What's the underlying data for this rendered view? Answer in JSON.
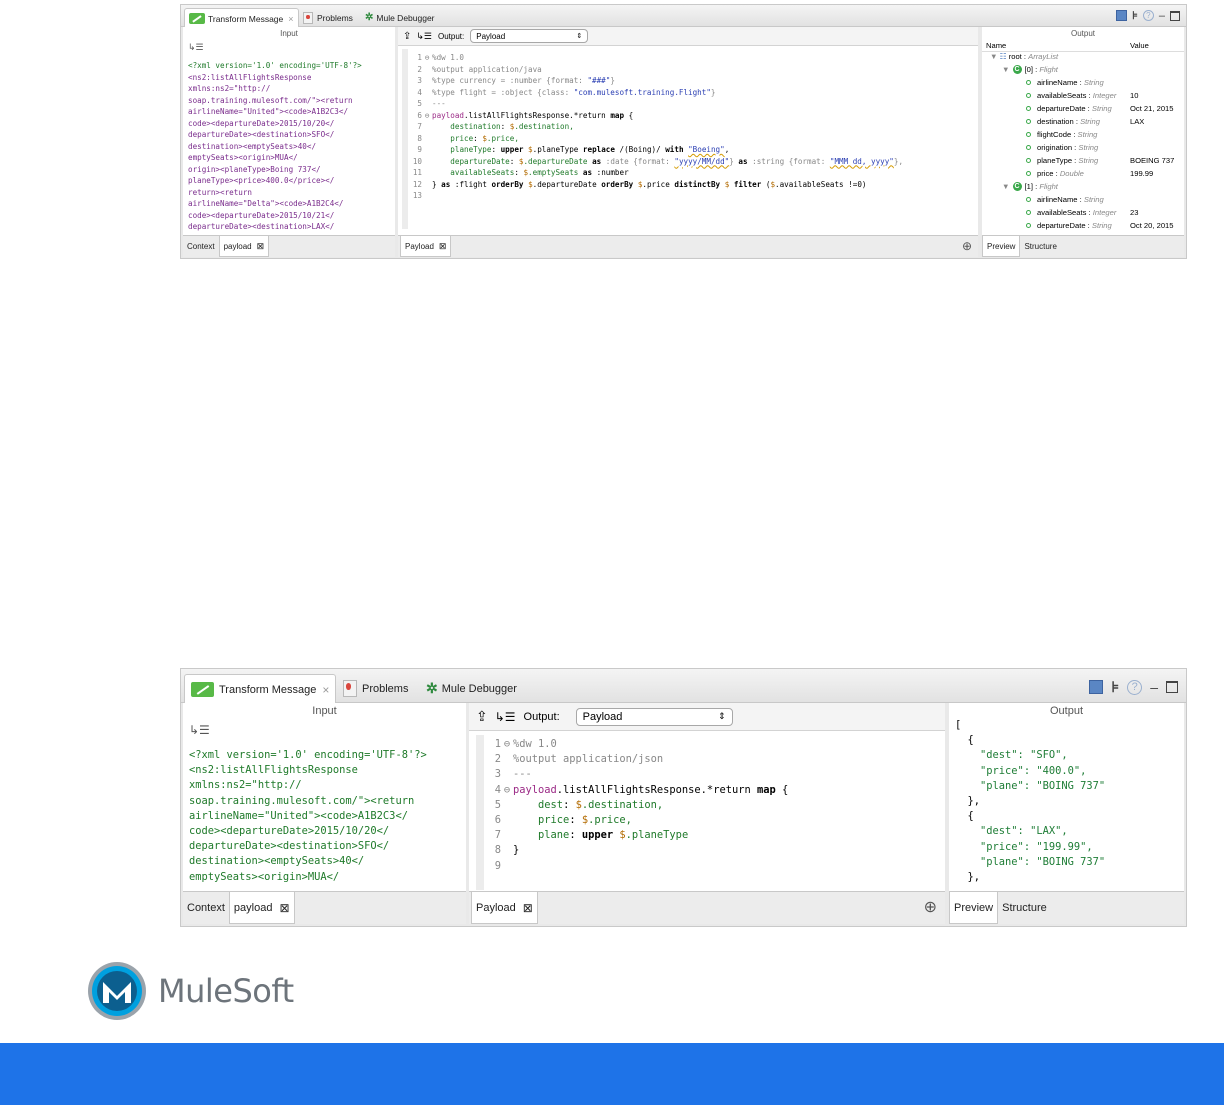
{
  "top": {
    "tabs": [
      "Transform Message",
      "Problems",
      "Mule Debugger"
    ],
    "input": {
      "header": "Input",
      "xml_lines": [
        "<?xml version='1.0' encoding='UTF-8'?>",
        "<ns2:listAllFlightsResponse",
        "xmlns:ns2=\"http://",
        "soap.training.mulesoft.com/\"><return",
        "airlineName=\"United\"><code>A1B2C3</",
        "code><departureDate>2015/10/20</",
        "departureDate><destination>SFO</",
        "destination><emptySeats>40</",
        "emptySeats><origin>MUA</",
        "origin><planeType>Boing 737</",
        "planeType><price>400.0</price></",
        "return><return",
        "airlineName=\"Delta\"><code>A1B2C4</",
        "code><departureDate>2015/10/21</",
        "departureDate><destination>LAX</"
      ],
      "bottom_tabs": [
        "Context",
        "payload"
      ]
    },
    "editor": {
      "output_label": "Output:",
      "output_select": "Payload",
      "line_numbers": [
        "1",
        "2",
        "3",
        "4",
        "5",
        "6",
        "7",
        "8",
        "9",
        "10",
        "11",
        "12",
        "13"
      ],
      "bottom_tab": "Payload"
    },
    "output": {
      "header": "Output",
      "col_name": "Name",
      "col_value": "Value",
      "tree": [
        {
          "name": "root",
          "type": "ArrayList",
          "value": ""
        },
        {
          "name": "[0]",
          "type": "Flight",
          "value": ""
        },
        {
          "name": "airlineName",
          "type": "String",
          "value": ""
        },
        {
          "name": "availableSeats",
          "type": "Integer",
          "value": "10"
        },
        {
          "name": "departureDate",
          "type": "String",
          "value": "Oct 21, 2015"
        },
        {
          "name": "destination",
          "type": "String",
          "value": "LAX"
        },
        {
          "name": "flightCode",
          "type": "String",
          "value": ""
        },
        {
          "name": "origination",
          "type": "String",
          "value": ""
        },
        {
          "name": "planeType",
          "type": "String",
          "value": "BOEING 737"
        },
        {
          "name": "price",
          "type": "Double",
          "value": "199.99"
        },
        {
          "name": "[1]",
          "type": "Flight",
          "value": ""
        },
        {
          "name": "airlineName",
          "type": "String",
          "value": ""
        },
        {
          "name": "availableSeats",
          "type": "Integer",
          "value": "23"
        },
        {
          "name": "departureDate",
          "type": "String",
          "value": "Oct 20, 2015"
        }
      ],
      "bottom_tabs": [
        "Preview",
        "Structure"
      ]
    }
  },
  "bottom": {
    "tabs": [
      "Transform Message",
      "Problems",
      "Mule Debugger"
    ],
    "input": {
      "header": "Input",
      "xml_lines": [
        "<?xml version='1.0' encoding='UTF-8'?>",
        "<ns2:listAllFlightsResponse",
        "xmlns:ns2=\"http://",
        "soap.training.mulesoft.com/\"><return",
        "airlineName=\"United\"><code>A1B2C3</",
        "code><departureDate>2015/10/20</",
        "departureDate><destination>SFO</",
        "destination><emptySeats>40</",
        "emptySeats><origin>MUA</"
      ],
      "bottom_tabs": [
        "Context",
        "payload"
      ]
    },
    "editor": {
      "output_label": "Output:",
      "output_select": "Payload",
      "line_numbers": [
        "1",
        "2",
        "3",
        "4",
        "5",
        "6",
        "7",
        "8",
        "9"
      ],
      "bottom_tab": "Payload"
    },
    "output": {
      "header": "Output",
      "json_lines": [
        "[",
        "  {",
        "    \"dest\": \"SFO\",",
        "    \"price\": \"400.0\",",
        "    \"plane\": \"BOING 737\"",
        "  },",
        "  {",
        "    \"dest\": \"LAX\",",
        "    \"price\": \"199.99\",",
        "    \"plane\": \"BOING 737\"",
        "  },"
      ],
      "bottom_tabs": [
        "Preview",
        "Structure"
      ]
    }
  },
  "brand": {
    "name": "MuleSoft"
  },
  "colors": {
    "footer": "#1e73e8",
    "accent_green": "#58b947"
  }
}
